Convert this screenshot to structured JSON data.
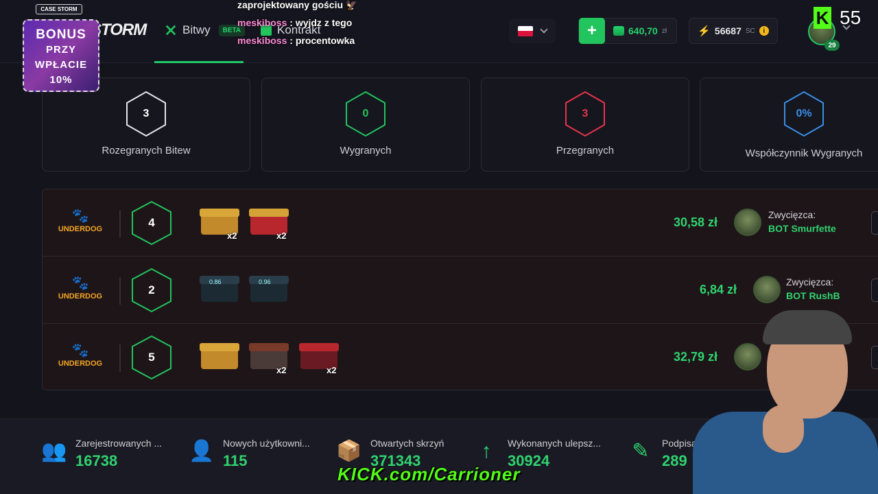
{
  "header": {
    "brand": "STORM",
    "nav": [
      {
        "label": "Bitwy",
        "badge": "BETA"
      },
      {
        "label": "Kontrakt"
      }
    ],
    "wallet": {
      "amount": "640,70",
      "currency": "zł"
    },
    "sc": {
      "amount": "56687",
      "currency": "SC"
    },
    "user_level": "29"
  },
  "overlay": {
    "case_storm_badge": "CASE STORM",
    "bonus": {
      "line1": "BONUS",
      "line2": "PRZY",
      "line3": "WPŁACIE",
      "line4": "10%"
    },
    "chat": [
      {
        "user": "",
        "text": "zaprojektowany gościu 🦅"
      },
      {
        "user": "meskiboss",
        "text": " : wyjdz z tego"
      },
      {
        "user": "meskiboss",
        "text": " : procentowka"
      }
    ],
    "kick_logo": "K",
    "viewers": "55",
    "kick_banner": "KICK.com/Carrioner"
  },
  "stats": [
    {
      "value": "3",
      "label": "Rozegranych Bitew",
      "color": "#ffffff"
    },
    {
      "value": "0",
      "label": "Wygranych",
      "color": "#22c45e"
    },
    {
      "value": "3",
      "label": "Przegranych",
      "color": "#e5344a"
    },
    {
      "value": "0%",
      "label": "Współczynnik Wygranych",
      "color": "#3a8ee6"
    }
  ],
  "battles": [
    {
      "mode": "UNDERDOG",
      "players": "4",
      "cases": [
        {
          "qty": "x2",
          "lid": "#d9a63a",
          "body": "#c28a2a",
          "price": ""
        },
        {
          "qty": "x2",
          "lid": "#d4a236",
          "body": "#b8262e",
          "price": ""
        }
      ],
      "total": "30,58 zł",
      "winner_label": "Zwycięzca:",
      "winner": "BOT Smurfette"
    },
    {
      "mode": "UNDERDOG",
      "players": "2",
      "cases": [
        {
          "qty": "",
          "lid": "#2a3d4a",
          "body": "#1c2a33",
          "price": "0.86"
        },
        {
          "qty": "",
          "lid": "#2a3d4a",
          "body": "#1c2a33",
          "price": "0.96"
        }
      ],
      "total": "6,84 zł",
      "winner_label": "Zwycięzca:",
      "winner": "BOT RushB"
    },
    {
      "mode": "UNDERDOG",
      "players": "5",
      "cases": [
        {
          "qty": "",
          "lid": "#d9a63a",
          "body": "#c28a2a",
          "price": ""
        },
        {
          "qty": "x2",
          "lid": "#7a3a2a",
          "body": "#4a3a38",
          "price": ""
        },
        {
          "qty": "x2",
          "lid": "#b8262e",
          "body": "#6a1a22",
          "price": ""
        }
      ],
      "total": "32,79 zł",
      "winner_label": "",
      "winner": ""
    }
  ],
  "footer": [
    {
      "icon": "users-icon",
      "label": "Zarejestrowanych ...",
      "value": "16738"
    },
    {
      "icon": "user-plus-icon",
      "label": "Nowych użytkowni...",
      "value": "115"
    },
    {
      "icon": "box-open-icon",
      "label": "Otwartych skrzyń",
      "value": "371343"
    },
    {
      "icon": "arrow-up-icon",
      "label": "Wykonanych ulepsz...",
      "value": "30924"
    },
    {
      "icon": "contract-sign-icon",
      "label": "Podpisanych k",
      "value": "289"
    }
  ]
}
